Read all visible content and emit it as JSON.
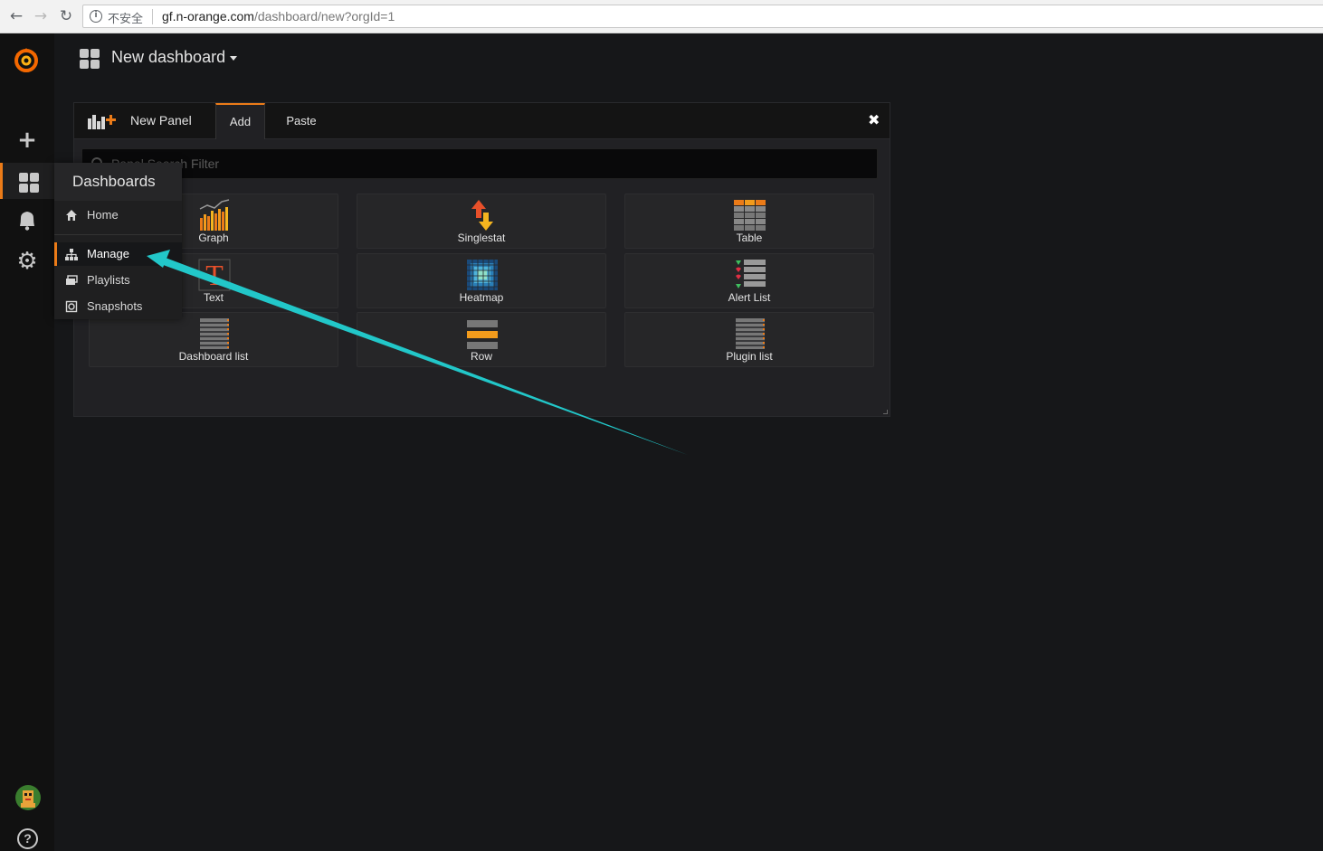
{
  "browser": {
    "insecure_label": "不安全",
    "url_host": "gf.n-orange.com",
    "url_path": "/dashboard/new?orgId=1"
  },
  "header": {
    "title": "New dashboard"
  },
  "dropdown": {
    "title": "Dashboards",
    "items": [
      {
        "label": "Home",
        "icon": "home-icon"
      },
      {
        "label": "Manage",
        "icon": "sitemap-icon",
        "active": true
      },
      {
        "label": "Playlists",
        "icon": "playlist-icon"
      },
      {
        "label": "Snapshots",
        "icon": "snapshot-icon"
      }
    ]
  },
  "panel": {
    "new_panel_label": "New Panel",
    "tabs": [
      "Add",
      "Paste"
    ],
    "filter_placeholder": "Panel Search Filter",
    "cards": [
      {
        "label": "Graph",
        "icon": "graph-icon"
      },
      {
        "label": "Singlestat",
        "icon": "singlestat-icon"
      },
      {
        "label": "Table",
        "icon": "table-icon"
      },
      {
        "label": "Text",
        "icon": "text-icon"
      },
      {
        "label": "Heatmap",
        "icon": "heatmap-icon"
      },
      {
        "label": "Alert List",
        "icon": "alert-list-icon"
      },
      {
        "label": "Dashboard list",
        "icon": "dashboard-list-icon"
      },
      {
        "label": "Row",
        "icon": "row-icon"
      },
      {
        "label": "Plugin list",
        "icon": "plugin-list-icon"
      }
    ]
  },
  "colors": {
    "accent": "#eb7b18",
    "annotation_arrow": "#22c7c9",
    "background": "#161719"
  }
}
